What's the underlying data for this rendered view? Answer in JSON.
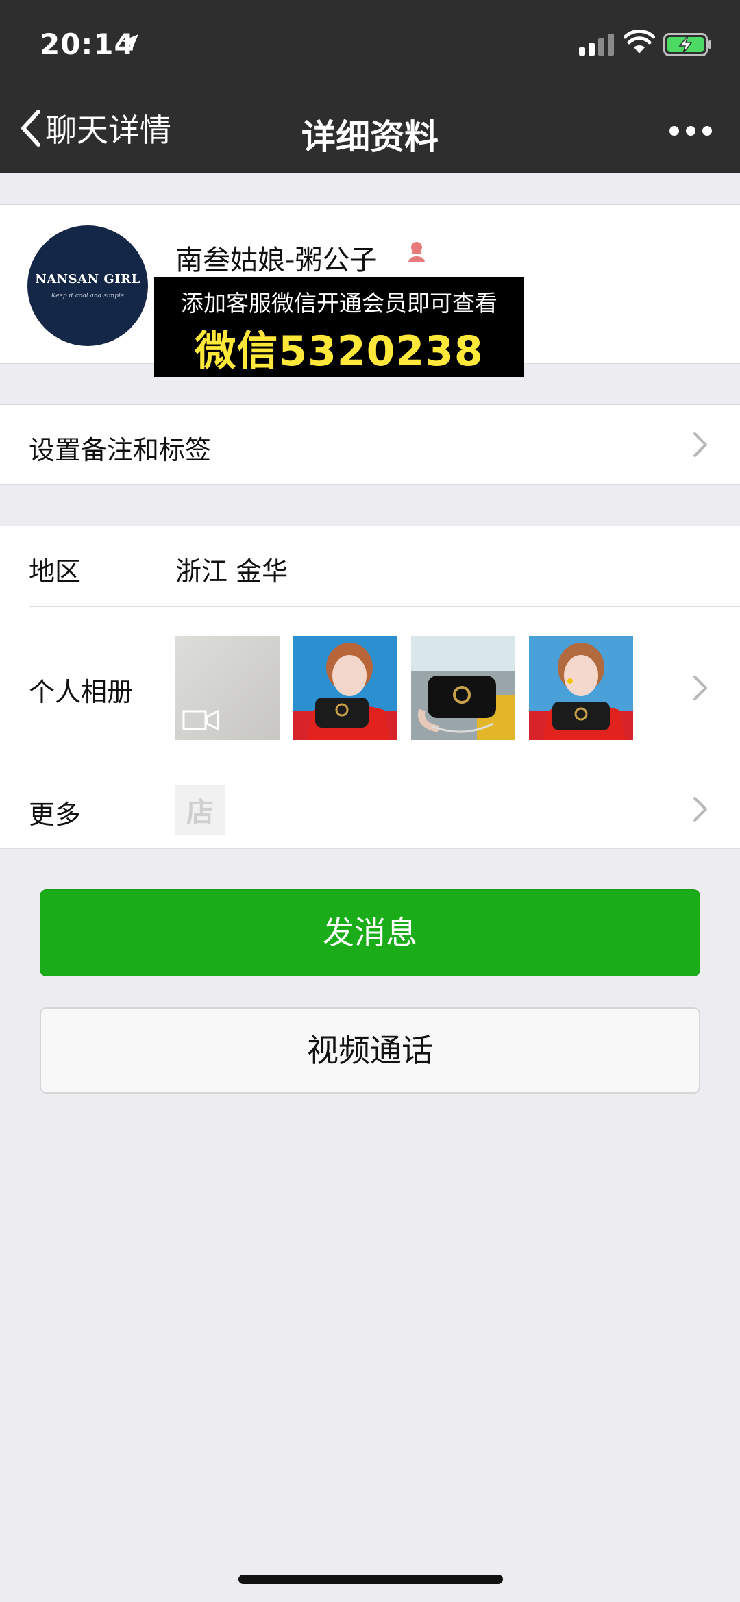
{
  "status_bar": {
    "time": "20:14",
    "icons": [
      "location-arrow-icon",
      "signal-icon",
      "wifi-icon",
      "battery-charging-icon"
    ]
  },
  "nav": {
    "back_label": "聊天详情",
    "title": "详细资料",
    "more_icon": "ellipsis-icon"
  },
  "profile": {
    "avatar_brand": "NANSAN GIRL",
    "avatar_slogan": "Keep it cool and simple",
    "nickname": "南叁姑娘-粥公子",
    "gender_icon": "female-icon",
    "promo_line1": "添加客服微信开通会员即可查看",
    "promo_line2": "微信5320238"
  },
  "rows": {
    "remark_label": "设置备注和标签",
    "region_label": "地区",
    "region_value": "浙江 金华",
    "album_label": "个人相册",
    "album_thumbs": [
      "video-thumb",
      "photo-red-top-bag",
      "photo-black-bag",
      "photo-selfie-bag"
    ],
    "more_label": "更多",
    "shop_glyph": "店"
  },
  "buttons": {
    "send_message": "发消息",
    "video_call": "视频通话"
  },
  "colors": {
    "nav_bg": "#2e2e2e",
    "page_bg": "#ededf1",
    "primary_green": "#1aad19",
    "promo_yellow": "#ffe83a"
  }
}
